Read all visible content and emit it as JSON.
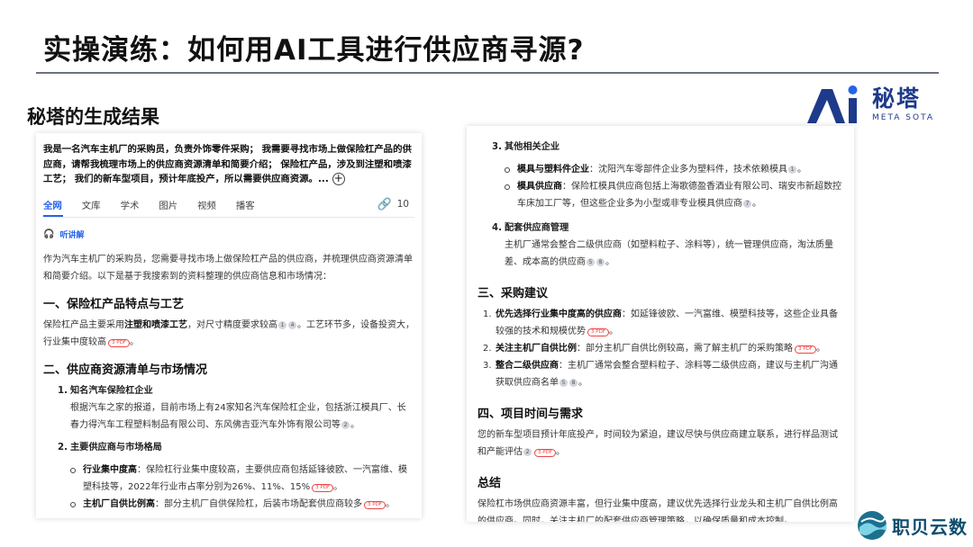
{
  "slide": {
    "title": "实操演练：如何用AI工具进行供应商寻源?",
    "section_title": "秘塔的生成结果"
  },
  "logo": {
    "cn": "秘塔",
    "en": "META SOTA",
    "color": "#1e3a8a"
  },
  "left": {
    "query": "我是一名汽车主机厂的采购员，负责外饰零件采购； 我需要寻找市场上做保险杠产品的供应商，请帮我梳理市场上的供应商资源清单和简要介绍； 保险杠产品，涉及到注塑和喷漆工艺； 我们的新车型项目，预计年底投产，所以需要供应商资源。...",
    "tabs": [
      "全网",
      "文库",
      "学术",
      "图片",
      "视频",
      "播客"
    ],
    "tab_count": "10",
    "listen_label": "听讲解",
    "intro": "作为汽车主机厂的采购员，您需要寻找市场上做保险杠产品的供应商，并梳理供应商资源清单和简要介绍。以下是基于我搜索到的资料整理的供应商信息和市场情况：",
    "s1_title": "一、保险杠产品特点与工艺",
    "s1_a": "保险杠产品主要采用",
    "s1_b": "注塑和喷漆工艺",
    "s1_c": "，对尺寸精度要求较高",
    "s1_d": "。工艺环节多，设备投资大，行业集中度较高",
    "s1_e": "。",
    "s2_title": "二、供应商资源清单与市场情况",
    "s2_1_num": "1.",
    "s2_1_title": "知名汽车保险杠企业",
    "s2_1_text": "根据汽车之家的报道，目前市场上有24家知名汽车保险杠企业，包括浙江模具厂、长春力得汽车工程塑料制品有限公司、东风佛吉亚汽车外饰有限公司等",
    "s2_1_end": "。",
    "s2_2_num": "2.",
    "s2_2_title": "主要供应商与市场格局",
    "s2_2_b1_label": "行业集中度高",
    "s2_2_b1_text": "：保险杠行业集中度较高，主要供应商包括延锋彼欧、一汽富维、模塑科技等，2022年行业市占率分别为26%、11%、15%",
    "s2_2_b1_end": "。",
    "s2_2_b2_label": "主机厂自供比例高",
    "s2_2_b2_text": "：部分主机厂自供保险杠，后装市场配套供应商较多",
    "s2_2_b2_end": "。"
  },
  "right": {
    "i3_num": "3.",
    "i3_title": "其他相关企业",
    "i3_b1_label": "模具与塑料件企业",
    "i3_b1_text": "：沈阳汽车零部件企业多为塑料件，技术依赖模具",
    "i3_b1_end": "。",
    "i3_b2_label": "模具供应商",
    "i3_b2_text": "：保险杠模具供应商包括上海歌德盈香酒业有限公司、瑞安市新超数控车床加工厂等，但这些企业多为小型或非专业模具供应商",
    "i3_b2_end": "。",
    "i4_num": "4.",
    "i4_title": "配套供应商管理",
    "i4_text": "主机厂通常会整合二级供应商（如塑料粒子、涂料等），统一管理供应商，淘汰质量差、成本高的供应商",
    "i4_end": "。",
    "s3_title": "三、采购建议",
    "r1_num": "1.",
    "r1_label": "优先选择行业集中度高的供应商",
    "r1_text": "：如延锋彼欧、一汽富维、模塑科技等，这些企业具备较强的技术和规模优势",
    "r1_end": "。",
    "r2_num": "2.",
    "r2_label": "关注主机厂自供比例",
    "r2_text": "：部分主机厂自供比例较高，需了解主机厂的采购策略",
    "r2_end": "。",
    "r3_num": "3.",
    "r3_label": "整合二级供应商",
    "r3_text": "：主机厂通常会整合塑料粒子、涂料等二级供应商，建议与主机厂沟通获取供应商名单",
    "r3_end": "。",
    "s4_title": "四、项目时间与需求",
    "s4_text": "您的新车型项目预计年底投产，时间较为紧迫，建议尽快与供应商建立联系，进行样品测试和产能评估",
    "s4_end": "。",
    "sum_title": "总结",
    "sum_text": "保险杠市场供应商资源丰富，但行业集中度高，建议优先选择行业龙头和主机厂自供比例高的供应商。同时，关注主机厂的配套供应商管理策略，以确保质量和成本控制。"
  },
  "citations": {
    "c1": "1",
    "c2": "2",
    "c4": "4",
    "c5": "5",
    "c7": "7",
    "c8": "8",
    "pdf3": "3 PDF"
  },
  "brand": {
    "name": "职贝云数",
    "color": "#0e4d6e"
  },
  "accent_color": "#2563eb"
}
